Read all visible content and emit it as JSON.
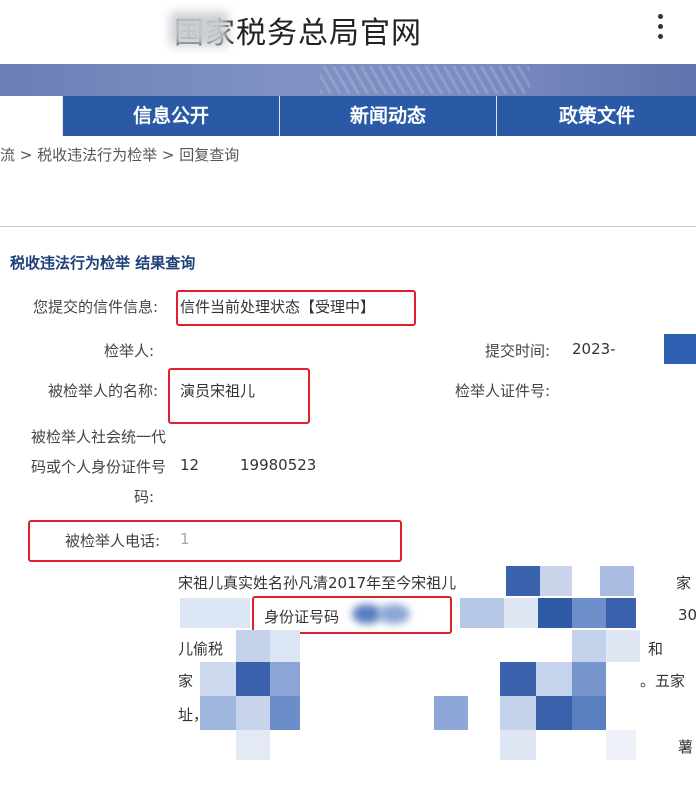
{
  "header": {
    "site_title": "国家税务总局官网",
    "menu_icon": "more-vertical-icon"
  },
  "nav": {
    "tabs": [
      {
        "label": "信息公开"
      },
      {
        "label": "新闻动态"
      },
      {
        "label": "政策文件"
      }
    ]
  },
  "breadcrumb": "流 > 税收违法行为检举 > 回复查询",
  "result": {
    "section_title": "税收违法行为检举 结果查询",
    "letter_info_label": "您提交的信件信息:",
    "letter_info_value": "信件当前处理状态【受理中】",
    "reporter_label": "检举人:",
    "submit_time_label": "提交时间:",
    "submit_time_value": "2023-",
    "reported_name_label": "被检举人的名称:",
    "reported_name_value": "演员宋祖儿",
    "reporter_id_label": "检举人证件号:",
    "credit_code_label_line1": "被检举人社会统一代",
    "credit_code_label_line2": "码或个人身份证件号",
    "credit_code_label_line3": "码:",
    "credit_code_value_prefix": "12",
    "credit_code_value_mid": "19980523",
    "phone_label": "被检举人电话:",
    "phone_value": "1",
    "content_line1": "宋祖儿真实姓名孙凡清2017年至今宋祖儿",
    "content_line1_tail": "家",
    "content_id_text": "身份证号码",
    "content_line2_tail": "30",
    "content_line3": "儿偷税",
    "content_line3_tail": "和",
    "content_line4": "家",
    "content_line4_tail": "。五家",
    "content_line5": "址，也",
    "content_line6_tail": "薯"
  },
  "colors": {
    "nav_bg": "#2a5aa6",
    "highlight_border": "#e0202a",
    "section_title": "#1f3f7a"
  }
}
